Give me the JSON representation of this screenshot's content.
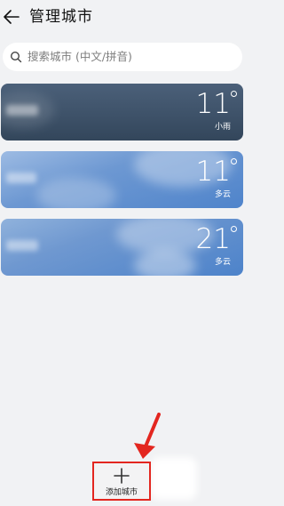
{
  "header": {
    "back_icon": "arrow-left-icon",
    "title": "管理城市"
  },
  "search": {
    "icon": "search-icon",
    "placeholder": "搜索城市 (中文/拼音)"
  },
  "cities": [
    {
      "temperature": "11",
      "condition": "小雨",
      "background": "#3f536b"
    },
    {
      "temperature": "11",
      "condition": "多云",
      "background": "#6b97d2"
    },
    {
      "temperature": "21",
      "condition": "多云",
      "background": "#6a95ce"
    }
  ],
  "add_city": {
    "icon": "plus-icon",
    "label": "添加城市"
  },
  "colors": {
    "background": "#f1f2f4",
    "annotation": "#e3261f"
  }
}
